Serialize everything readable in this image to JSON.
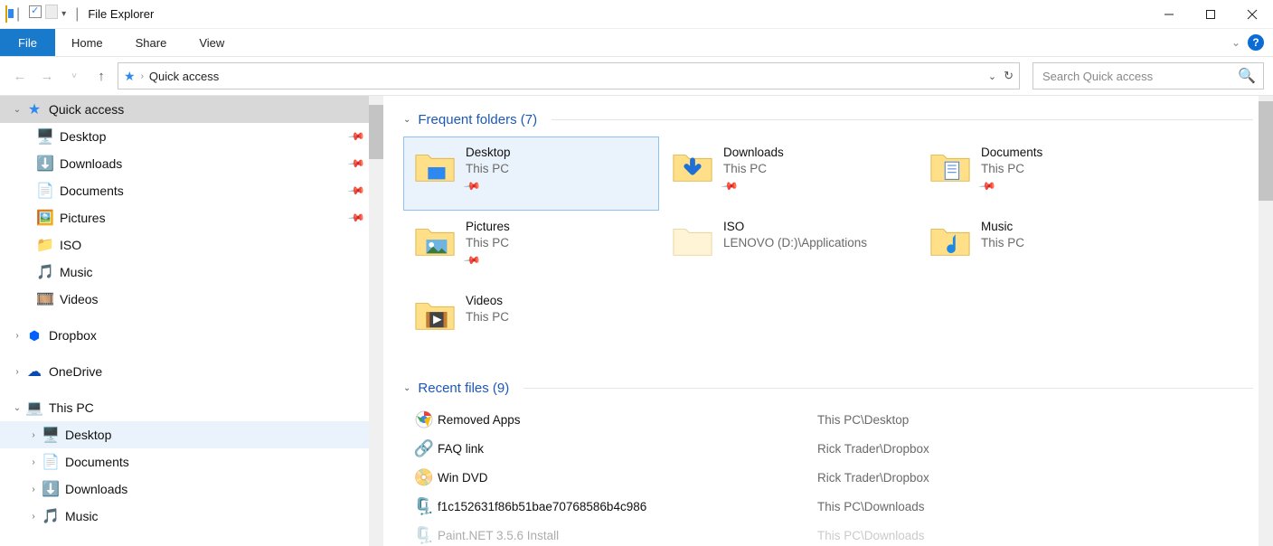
{
  "window": {
    "title": "File Explorer"
  },
  "ribbon": {
    "file": "File",
    "home": "Home",
    "share": "Share",
    "view": "View"
  },
  "address": {
    "location": "Quick access"
  },
  "search": {
    "placeholder": "Search Quick access"
  },
  "nav": {
    "quick_access": "Quick access",
    "desktop": "Desktop",
    "downloads": "Downloads",
    "documents": "Documents",
    "pictures": "Pictures",
    "iso": "ISO",
    "music": "Music",
    "videos": "Videos",
    "dropbox": "Dropbox",
    "onedrive": "OneDrive",
    "this_pc": "This PC",
    "pc_desktop": "Desktop",
    "pc_documents": "Documents",
    "pc_downloads": "Downloads",
    "pc_music": "Music"
  },
  "groups": {
    "frequent": "Frequent folders (7)",
    "recent": "Recent files (9)"
  },
  "folders": {
    "desktop": {
      "name": "Desktop",
      "sub": "This PC",
      "pinned": true
    },
    "downloads": {
      "name": "Downloads",
      "sub": "This PC",
      "pinned": true
    },
    "documents": {
      "name": "Documents",
      "sub": "This PC",
      "pinned": true
    },
    "pictures": {
      "name": "Pictures",
      "sub": "This PC",
      "pinned": true
    },
    "iso": {
      "name": "ISO",
      "sub": "LENOVO (D:)\\Applications",
      "pinned": false
    },
    "music": {
      "name": "Music",
      "sub": "This PC",
      "pinned": false
    },
    "videos": {
      "name": "Videos",
      "sub": "This PC",
      "pinned": false
    }
  },
  "recent": {
    "r1": {
      "name": "Removed Apps",
      "path": "This PC\\Desktop"
    },
    "r2": {
      "name": "FAQ link",
      "path": "Rick Trader\\Dropbox"
    },
    "r3": {
      "name": "Win DVD",
      "path": "Rick Trader\\Dropbox"
    },
    "r4": {
      "name": "f1c152631f86b51bae70768586b4c986",
      "path": "This PC\\Downloads"
    },
    "r5": {
      "name": "Paint.NET 3.5.6 Install",
      "path": "This PC\\Downloads"
    }
  }
}
